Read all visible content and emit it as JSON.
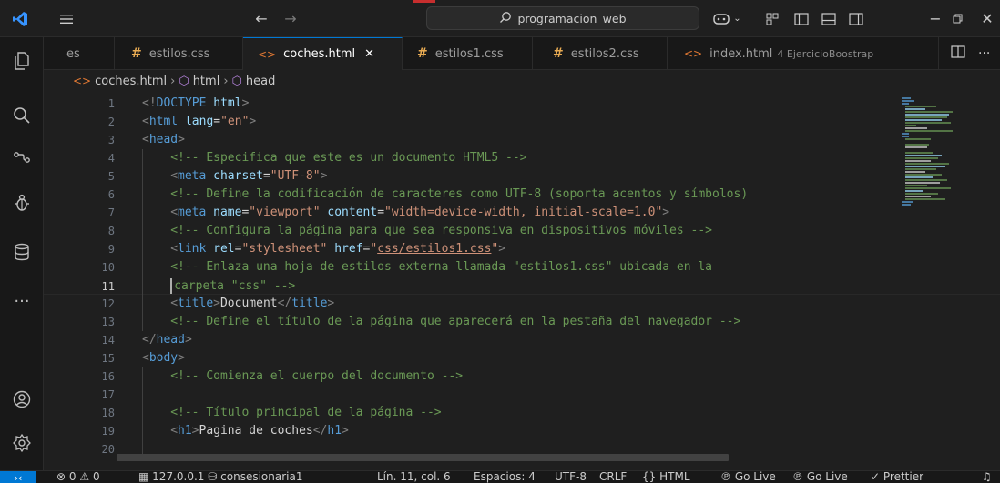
{
  "titlebar": {
    "search_text": "programacion_web",
    "icons": [
      "vscode-logo-icon",
      "menu-icon",
      "arrow-left-icon",
      "arrow-right-icon",
      "search-icon",
      "copilot-icon",
      "chevron-down-icon",
      "customize-layout-icon",
      "toggle-sidebar-icon",
      "toggle-panel-icon",
      "toggle-secondary-sidebar-icon",
      "minimize-icon",
      "restore-icon",
      "close-icon"
    ]
  },
  "activitybar": {
    "icons": [
      "explorer-icon",
      "search-icon",
      "source-control-icon",
      "run-debug-icon",
      "database-icon",
      "more-icon",
      "accounts-icon",
      "manage-icon"
    ]
  },
  "tabs": [
    {
      "label": "es",
      "type": "partial"
    },
    {
      "label": "estilos.css",
      "type": "css"
    },
    {
      "label": "coches.html",
      "type": "html",
      "active": true
    },
    {
      "label": "estilos1.css",
      "type": "css"
    },
    {
      "label": "estilos2.css",
      "type": "css"
    },
    {
      "label": "index.html",
      "type": "html",
      "desc": "4 EjercicioBoostrap"
    }
  ],
  "breadcrumb": [
    "coches.html",
    "html",
    "head"
  ],
  "editor": {
    "lines": [
      {
        "n": "1",
        "indent": 1
      },
      {
        "n": "2",
        "indent": 1
      },
      {
        "n": "3",
        "indent": 1
      },
      {
        "n": "4",
        "indent": 2
      },
      {
        "n": "5",
        "indent": 2
      },
      {
        "n": "6",
        "indent": 2
      },
      {
        "n": "7",
        "indent": 2
      },
      {
        "n": "8",
        "indent": 2
      },
      {
        "n": "9",
        "indent": 2
      },
      {
        "n": "10",
        "indent": 2
      },
      {
        "n": "11",
        "indent": 2,
        "current": true
      },
      {
        "n": "12",
        "indent": 2
      },
      {
        "n": "13",
        "indent": 2
      },
      {
        "n": "14",
        "indent": 1
      },
      {
        "n": "15",
        "indent": 1
      },
      {
        "n": "16",
        "indent": 2
      },
      {
        "n": "17",
        "indent": 2
      },
      {
        "n": "18",
        "indent": 2
      },
      {
        "n": "19",
        "indent": 2
      },
      {
        "n": "20",
        "indent": 2
      }
    ],
    "code": {
      "l1": {
        "a": "<!",
        "b": "DOCTYPE",
        "c": " html",
        "d": ">"
      },
      "l2": {
        "a": "<",
        "b": "html",
        "c": " lang",
        "d": "=",
        "e": "\"en\"",
        "f": ">"
      },
      "l3": {
        "a": "<",
        "b": "head",
        "c": ">"
      },
      "l4": "<!-- Especifica que este es un documento HTML5 -->",
      "l5": {
        "a": "<",
        "b": "meta",
        "c": " charset",
        "d": "=",
        "e": "\"UTF-8\"",
        "f": ">"
      },
      "l6": "<!-- Define la codificación de caracteres como UTF-8 (soporta acentos y símbolos)",
      "l7": {
        "a": "<",
        "b": "meta",
        "c": " name",
        "d": "=",
        "e": "\"viewport\"",
        "f": " content",
        "g": "=",
        "h": "\"width=device-width, initial-scale=1.0\"",
        "i": ">"
      },
      "l8": "<!-- Configura la página para que sea responsiva en dispositivos móviles -->",
      "l9": {
        "a": "<",
        "b": "link",
        "c": " rel",
        "d": "=",
        "e": "\"stylesheet\"",
        "f": " href",
        "g": "=",
        "h1": "\"",
        "h2": "css/estilos1.css",
        "h3": "\"",
        "i": ">"
      },
      "l10": "<!-- Enlaza una hoja de estilos externa llamada \"estilos1.css\" ubicada en la",
      "l11": "carpeta \"css\" -->",
      "l12": {
        "a": "<",
        "b": "title",
        "c": ">",
        "d": "Document",
        "e": "</",
        "f": "title",
        "g": ">"
      },
      "l13": "<!-- Define el título de la página que aparecerá en la pestaña del navegador -->",
      "l14": {
        "a": "</",
        "b": "head",
        "c": ">"
      },
      "l15": {
        "a": "<",
        "b": "body",
        "c": ">"
      },
      "l16": "<!-- Comienza el cuerpo del documento -->",
      "l17": "",
      "l18": "<!-- Título principal de la página -->",
      "l19": {
        "a": "<",
        "b": "h1",
        "c": ">",
        "d": "Pagina de coches",
        "e": "</",
        "f": "h1",
        "g": ">"
      },
      "l20": ""
    }
  },
  "statusbar": {
    "errors": "0",
    "warnings": "0",
    "host": "127.0.0.1",
    "database": "consesionaria1",
    "position": "Lín. 11, col. 6",
    "spaces": "Espacios: 4",
    "encoding": "UTF-8",
    "eol": "CRLF",
    "language": "HTML",
    "golive1": "Go Live",
    "golive2": "Go Live",
    "prettier": "Prettier"
  },
  "colors": {
    "accent": "#0078d4",
    "css_icon": "#e8ab53",
    "html_icon": "#e37933",
    "comment": "#6a9955",
    "tag": "#569cd6",
    "attr": "#9cdcfe",
    "string": "#ce9178"
  }
}
